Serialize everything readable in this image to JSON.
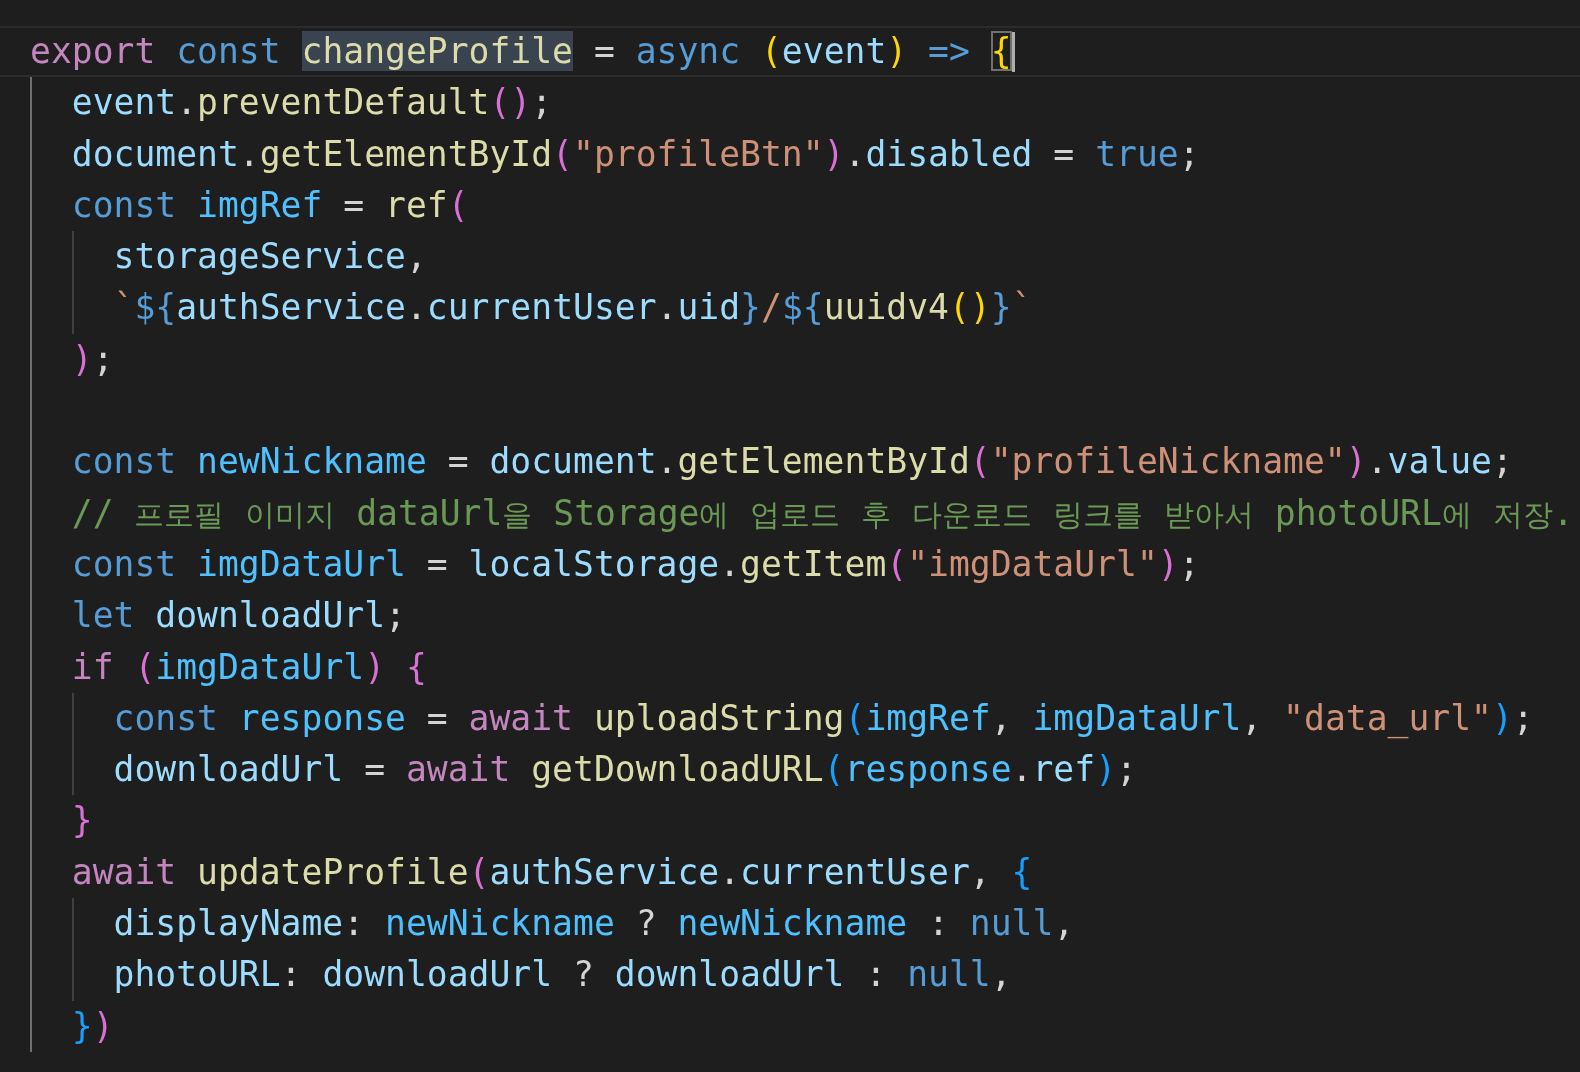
{
  "editor": {
    "lines": [
      {
        "current": true,
        "tokens": [
          {
            "text": "export ",
            "kind": "kw"
          },
          {
            "text": "const ",
            "kind": "st"
          },
          {
            "text": "changeProfile",
            "kind": "selection"
          },
          {
            "text": " = ",
            "kind": "p"
          },
          {
            "text": "async ",
            "kind": "st"
          },
          {
            "text": "(",
            "kind": "b1"
          },
          {
            "text": "event",
            "kind": "var"
          },
          {
            "text": ")",
            "kind": "b1"
          },
          {
            "text": " => ",
            "kind": "st"
          },
          {
            "text": "{",
            "kind": "match"
          }
        ]
      },
      {
        "current": false,
        "tokens": [
          {
            "text": "  event",
            "kind": "var"
          },
          {
            "text": ".",
            "kind": "p"
          },
          {
            "text": "preventDefault",
            "kind": "fn"
          },
          {
            "text": "()",
            "kind": "b2"
          },
          {
            "text": ";",
            "kind": "p"
          }
        ]
      },
      {
        "current": false,
        "tokens": [
          {
            "text": "  document",
            "kind": "var"
          },
          {
            "text": ".",
            "kind": "p"
          },
          {
            "text": "getElementById",
            "kind": "fn"
          },
          {
            "text": "(",
            "kind": "b2"
          },
          {
            "text": "\"profileBtn\"",
            "kind": "str"
          },
          {
            "text": ")",
            "kind": "b2"
          },
          {
            "text": ".",
            "kind": "p"
          },
          {
            "text": "disabled",
            "kind": "var"
          },
          {
            "text": " = ",
            "kind": "p"
          },
          {
            "text": "true",
            "kind": "st"
          },
          {
            "text": ";",
            "kind": "p"
          }
        ]
      },
      {
        "current": false,
        "tokens": [
          {
            "text": "  const ",
            "kind": "st"
          },
          {
            "text": "imgRef",
            "kind": "const"
          },
          {
            "text": " = ",
            "kind": "p"
          },
          {
            "text": "ref",
            "kind": "fn"
          },
          {
            "text": "(",
            "kind": "b2"
          }
        ]
      },
      {
        "current": false,
        "tokens": [
          {
            "text": "    storageService",
            "kind": "var"
          },
          {
            "text": ",",
            "kind": "p"
          }
        ]
      },
      {
        "current": false,
        "tokens": [
          {
            "text": "    `",
            "kind": "str"
          },
          {
            "text": "${",
            "kind": "st"
          },
          {
            "text": "authService",
            "kind": "var"
          },
          {
            "text": ".",
            "kind": "p"
          },
          {
            "text": "currentUser",
            "kind": "var"
          },
          {
            "text": ".",
            "kind": "p"
          },
          {
            "text": "uid",
            "kind": "var"
          },
          {
            "text": "}",
            "kind": "st"
          },
          {
            "text": "/",
            "kind": "str"
          },
          {
            "text": "${",
            "kind": "st"
          },
          {
            "text": "uuidv4",
            "kind": "fn"
          },
          {
            "text": "()",
            "kind": "b1"
          },
          {
            "text": "}",
            "kind": "st"
          },
          {
            "text": "`",
            "kind": "str"
          }
        ]
      },
      {
        "current": false,
        "tokens": [
          {
            "text": "  )",
            "kind": "b2"
          },
          {
            "text": ";",
            "kind": "p"
          }
        ]
      },
      {
        "current": false
      },
      {
        "current": false,
        "tokens": [
          {
            "text": "  const ",
            "kind": "st"
          },
          {
            "text": "newNickname",
            "kind": "const"
          },
          {
            "text": " = ",
            "kind": "p"
          },
          {
            "text": "document",
            "kind": "var"
          },
          {
            "text": ".",
            "kind": "p"
          },
          {
            "text": "getElementById",
            "kind": "fn"
          },
          {
            "text": "(",
            "kind": "b2"
          },
          {
            "text": "\"profileNickname\"",
            "kind": "str"
          },
          {
            "text": ")",
            "kind": "b2"
          },
          {
            "text": ".",
            "kind": "p"
          },
          {
            "text": "value",
            "kind": "var"
          },
          {
            "text": ";",
            "kind": "p"
          }
        ]
      },
      {
        "current": false,
        "tokens": [
          {
            "text": "  // 프로필 이미지 dataUrl을 Storage에 업로드 후 다운로드 링크를 받아서 photoURL에 저장.",
            "kind": "cm"
          }
        ]
      },
      {
        "current": false,
        "tokens": [
          {
            "text": "  const ",
            "kind": "st"
          },
          {
            "text": "imgDataUrl",
            "kind": "const"
          },
          {
            "text": " = ",
            "kind": "p"
          },
          {
            "text": "localStorage",
            "kind": "var"
          },
          {
            "text": ".",
            "kind": "p"
          },
          {
            "text": "getItem",
            "kind": "fn"
          },
          {
            "text": "(",
            "kind": "b2"
          },
          {
            "text": "\"imgDataUrl\"",
            "kind": "str"
          },
          {
            "text": ")",
            "kind": "b2"
          },
          {
            "text": ";",
            "kind": "p"
          }
        ]
      },
      {
        "current": false,
        "tokens": [
          {
            "text": "  let ",
            "kind": "st"
          },
          {
            "text": "downloadUrl",
            "kind": "var"
          },
          {
            "text": ";",
            "kind": "p"
          }
        ]
      },
      {
        "current": false,
        "tokens": [
          {
            "text": "  if ",
            "kind": "kw"
          },
          {
            "text": "(",
            "kind": "b2"
          },
          {
            "text": "imgDataUrl",
            "kind": "const"
          },
          {
            "text": ")",
            "kind": "b2"
          },
          {
            "text": " {",
            "kind": "b2"
          }
        ]
      },
      {
        "current": false,
        "tokens": [
          {
            "text": "    const ",
            "kind": "st"
          },
          {
            "text": "response",
            "kind": "const"
          },
          {
            "text": " = ",
            "kind": "p"
          },
          {
            "text": "await ",
            "kind": "kw"
          },
          {
            "text": "uploadString",
            "kind": "fn"
          },
          {
            "text": "(",
            "kind": "b3"
          },
          {
            "text": "imgRef",
            "kind": "const"
          },
          {
            "text": ", ",
            "kind": "p"
          },
          {
            "text": "imgDataUrl",
            "kind": "const"
          },
          {
            "text": ", ",
            "kind": "p"
          },
          {
            "text": "\"data_url\"",
            "kind": "str"
          },
          {
            "text": ")",
            "kind": "b3"
          },
          {
            "text": ";",
            "kind": "p"
          }
        ]
      },
      {
        "current": false,
        "tokens": [
          {
            "text": "    downloadUrl",
            "kind": "var"
          },
          {
            "text": " = ",
            "kind": "p"
          },
          {
            "text": "await ",
            "kind": "kw"
          },
          {
            "text": "getDownloadURL",
            "kind": "fn"
          },
          {
            "text": "(",
            "kind": "b3"
          },
          {
            "text": "response",
            "kind": "const"
          },
          {
            "text": ".",
            "kind": "p"
          },
          {
            "text": "ref",
            "kind": "var"
          },
          {
            "text": ")",
            "kind": "b3"
          },
          {
            "text": ";",
            "kind": "p"
          }
        ]
      },
      {
        "current": false,
        "tokens": [
          {
            "text": "  }",
            "kind": "b2"
          }
        ]
      },
      {
        "current": false,
        "tokens": [
          {
            "text": "  await ",
            "kind": "kw"
          },
          {
            "text": "updateProfile",
            "kind": "fn"
          },
          {
            "text": "(",
            "kind": "b2"
          },
          {
            "text": "authService",
            "kind": "var"
          },
          {
            "text": ".",
            "kind": "p"
          },
          {
            "text": "currentUser",
            "kind": "var"
          },
          {
            "text": ", ",
            "kind": "p"
          },
          {
            "text": "{",
            "kind": "b3"
          }
        ]
      },
      {
        "current": false,
        "tokens": [
          {
            "text": "    displayName",
            "kind": "var"
          },
          {
            "text": ": ",
            "kind": "p"
          },
          {
            "text": "newNickname",
            "kind": "const"
          },
          {
            "text": " ? ",
            "kind": "p"
          },
          {
            "text": "newNickname",
            "kind": "const"
          },
          {
            "text": " : ",
            "kind": "p"
          },
          {
            "text": "null",
            "kind": "st"
          },
          {
            "text": ",",
            "kind": "p"
          }
        ]
      },
      {
        "current": false,
        "tokens": [
          {
            "text": "    photoURL",
            "kind": "var"
          },
          {
            "text": ": ",
            "kind": "p"
          },
          {
            "text": "downloadUrl",
            "kind": "var"
          },
          {
            "text": " ? ",
            "kind": "p"
          },
          {
            "text": "downloadUrl",
            "kind": "var"
          },
          {
            "text": " : ",
            "kind": "p"
          },
          {
            "text": "null",
            "kind": "st"
          },
          {
            "text": ",",
            "kind": "p"
          }
        ]
      },
      {
        "current": false,
        "tokens": [
          {
            "text": "  }",
            "kind": "b3"
          },
          {
            "text": ")",
            "kind": "b2"
          }
        ]
      }
    ]
  }
}
